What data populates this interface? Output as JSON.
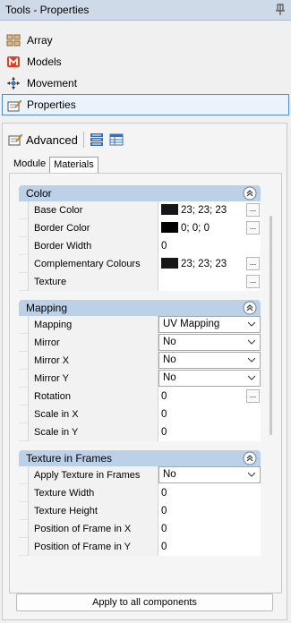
{
  "window": {
    "title": "Tools - Properties"
  },
  "nav": {
    "items": [
      {
        "label": "Array",
        "icon": "array-icon"
      },
      {
        "label": "Models",
        "icon": "models-icon"
      },
      {
        "label": "Movement",
        "icon": "movement-icon"
      },
      {
        "label": "Properties",
        "icon": "properties-icon",
        "active": true
      }
    ]
  },
  "toolbar": {
    "advanced_label": "Advanced"
  },
  "tabs": [
    {
      "label": "Module"
    },
    {
      "label": "Materials",
      "active": true
    }
  ],
  "sections": {
    "color": {
      "title": "Color",
      "rows": [
        {
          "label": "Base Color",
          "value": "23; 23; 23"
        },
        {
          "label": "Border Color",
          "value": "0; 0; 0"
        },
        {
          "label": "Border Width",
          "value": "0"
        },
        {
          "label": "Complementary Colours",
          "value": "23; 23; 23"
        },
        {
          "label": "Texture",
          "value": ""
        }
      ]
    },
    "mapping": {
      "title": "Mapping",
      "rows": [
        {
          "label": "Mapping",
          "value": "UV Mapping"
        },
        {
          "label": "Mirror",
          "value": "No"
        },
        {
          "label": "Mirror X",
          "value": "No"
        },
        {
          "label": "Mirror Y",
          "value": "No"
        },
        {
          "label": "Rotation",
          "value": "0"
        },
        {
          "label": "Scale in X",
          "value": "0"
        },
        {
          "label": "Scale in Y",
          "value": "0"
        }
      ]
    },
    "frames": {
      "title": "Texture in Frames",
      "rows": [
        {
          "label": "Apply Texture in Frames",
          "value": "No"
        },
        {
          "label": "Texture Width",
          "value": "0"
        },
        {
          "label": "Texture Height",
          "value": "0"
        },
        {
          "label": "Position of Frame  in X",
          "value": "0"
        },
        {
          "label": "Position of Frame  in Y",
          "value": "0"
        }
      ]
    }
  },
  "apply_button": "Apply to all components",
  "colors": {
    "section_header": "#bcd0e8",
    "active_border": "#4f8ac9",
    "titlebar": "#cfdae8",
    "swatch": "#171717"
  }
}
